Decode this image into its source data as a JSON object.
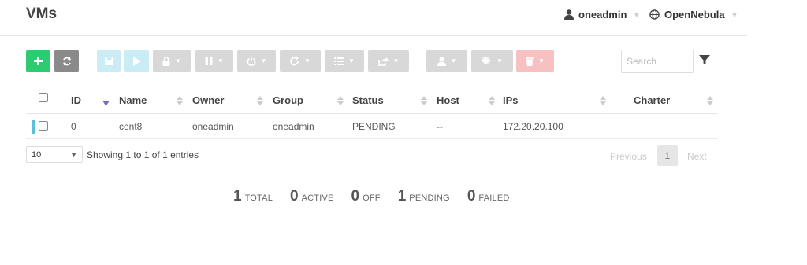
{
  "header": {
    "title": "VMs",
    "user": "oneadmin",
    "zone": "OpenNebula"
  },
  "toolbar": {
    "create_icon": "plus-icon",
    "refresh_icon": "refresh-icon",
    "save_icon": "save-icon",
    "deploy_icon": "play-icon",
    "lock_icon": "lock-icon",
    "pause_icon": "pause-icon",
    "power_icon": "power-icon",
    "reboot_icon": "reboot-icon",
    "list_icon": "list-icon",
    "export_icon": "export-icon",
    "owner_icon": "user-icon",
    "label_icon": "tags-icon",
    "delete_icon": "trash-icon"
  },
  "search": {
    "placeholder": "Search"
  },
  "table": {
    "columns": [
      "ID",
      "Name",
      "Owner",
      "Group",
      "Status",
      "Host",
      "IPs",
      "Charter"
    ],
    "rows": [
      {
        "id": "0",
        "name": "cent8",
        "owner": "oneadmin",
        "group": "oneadmin",
        "status": "PENDING",
        "host": "--",
        "ips": "172.20.20.100",
        "charter": ""
      }
    ]
  },
  "footer": {
    "page_length": "10",
    "info": "Showing 1 to 1 of 1 entries",
    "previous": "Previous",
    "page": "1",
    "next": "Next"
  },
  "stats": [
    {
      "value": "1",
      "label": "TOTAL"
    },
    {
      "value": "0",
      "label": "ACTIVE"
    },
    {
      "value": "0",
      "label": "OFF"
    },
    {
      "value": "1",
      "label": "PENDING"
    },
    {
      "value": "0",
      "label": "FAILED"
    }
  ],
  "colors": {
    "create": "#2ecc71",
    "refresh": "#8a8a8a",
    "state_pending": "#5bc0de",
    "delete": "#f7c1c1"
  }
}
